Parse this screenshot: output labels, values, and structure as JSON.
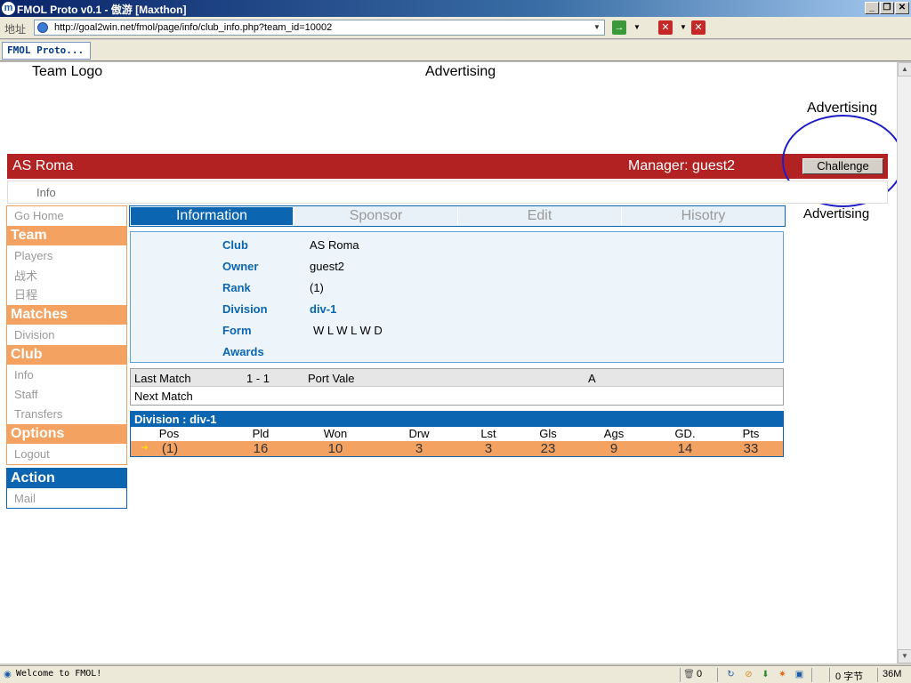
{
  "window": {
    "title": "FMOL Proto v0.1 - 傲游 [Maxthon]"
  },
  "address": {
    "label": "地址",
    "url": "http://goal2win.net/fmol/page/info/club_info.php?team_id=10002"
  },
  "tabs": [
    {
      "label": "FMOL Proto..."
    }
  ],
  "page": {
    "team_logo": "Team Logo",
    "ad_top": "Advertising",
    "ad_right1": "Advertising",
    "ad_right2": "Advertising",
    "club_name": "AS Roma",
    "manager": "Manager: guest2",
    "challenge_label": "Challenge",
    "info_tab": "Info"
  },
  "menu": {
    "go_home": "Go Home",
    "team": {
      "label": "Team",
      "items": [
        "Players",
        "战术",
        "日程"
      ]
    },
    "matches": {
      "label": "Matches",
      "items": [
        "Division"
      ]
    },
    "club": {
      "label": "Club",
      "items": [
        "Info",
        "Staff",
        "Transfers"
      ]
    },
    "options": {
      "label": "Options",
      "items": [
        "Logout"
      ]
    },
    "action": {
      "label": "Action",
      "items": [
        "Mail"
      ]
    }
  },
  "content_tabs": [
    "Information",
    "Sponsor",
    "Edit",
    "Hisotry"
  ],
  "details": [
    {
      "label": "Club",
      "value": "AS Roma"
    },
    {
      "label": "Owner",
      "value": "guest2"
    },
    {
      "label": "Rank",
      "value": "(1)"
    },
    {
      "label": "Division",
      "value": "div-1"
    },
    {
      "label": "Form",
      "value": "W L W L W D"
    },
    {
      "label": "Awards",
      "value": ""
    }
  ],
  "matches": {
    "last": {
      "label": "Last Match",
      "score": "1 - 1",
      "opponent": "Port Vale",
      "venue": "A"
    },
    "next": {
      "label": "Next Match"
    }
  },
  "division": {
    "title": "Division : div-1",
    "columns": [
      "Pos",
      "Pld",
      "Won",
      "Drw",
      "Lst",
      "Gls",
      "Ags",
      "GD.",
      "Pts"
    ],
    "row": [
      "(1)",
      "16",
      "10",
      "3",
      "3",
      "23",
      "9",
      "14",
      "33"
    ]
  },
  "status": {
    "text": "Welcome to FMOL!",
    "trash_count": "0",
    "bytes": "0 字节",
    "memory": "36M"
  }
}
